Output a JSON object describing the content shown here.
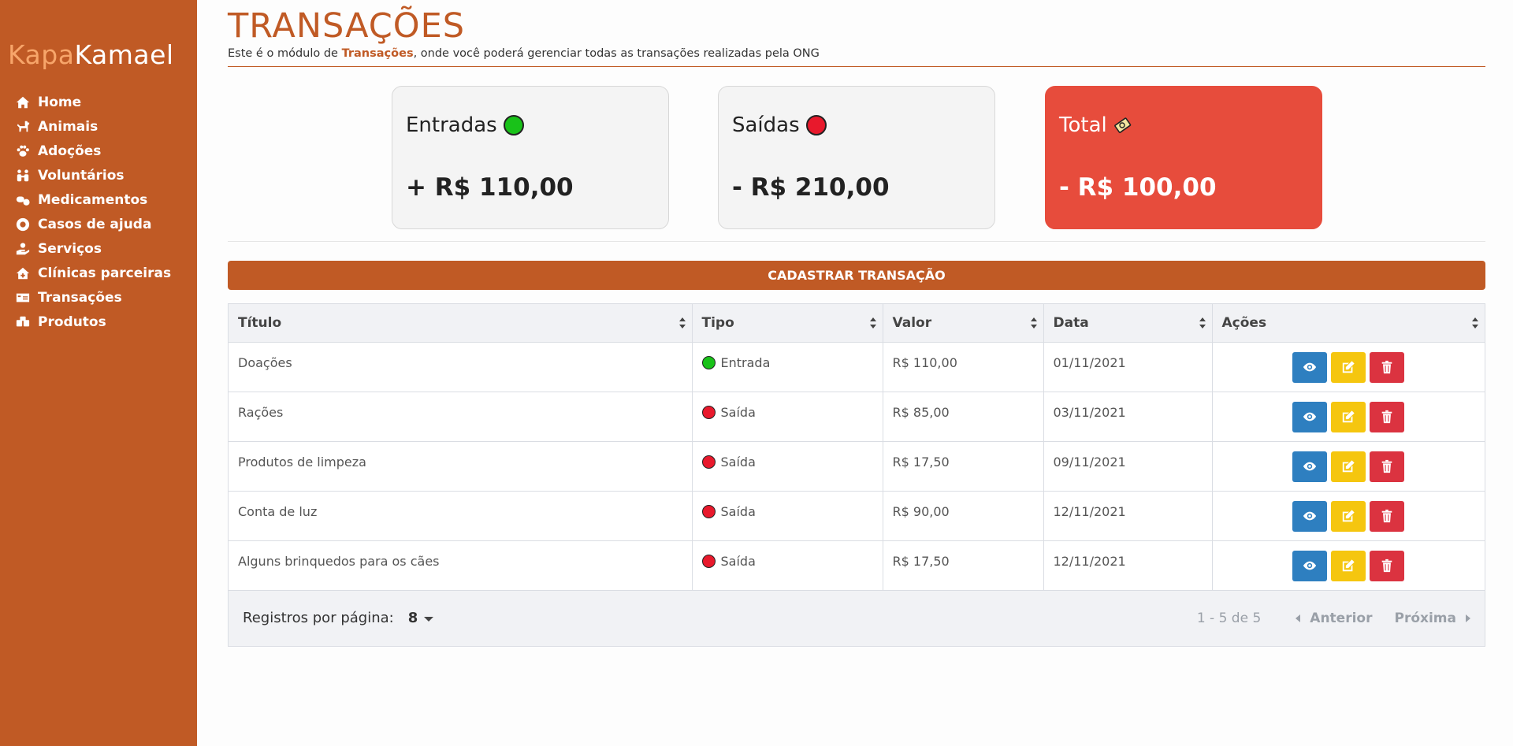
{
  "brand": {
    "part1": "Kapa",
    "part2": "Kamael"
  },
  "sidebar": {
    "items": [
      {
        "label": "Home",
        "icon": "home-icon"
      },
      {
        "label": "Animais",
        "icon": "dog-icon"
      },
      {
        "label": "Adoções",
        "icon": "paw-icon"
      },
      {
        "label": "Voluntários",
        "icon": "people-icon"
      },
      {
        "label": "Medicamentos",
        "icon": "pills-icon"
      },
      {
        "label": "Casos de ajuda",
        "icon": "lifebuoy-icon"
      },
      {
        "label": "Serviços",
        "icon": "hand-icon"
      },
      {
        "label": "Clínicas parceiras",
        "icon": "clinic-icon"
      },
      {
        "label": "Transações",
        "icon": "money-icon"
      },
      {
        "label": "Produtos",
        "icon": "boxes-icon"
      }
    ]
  },
  "header": {
    "title": "TRANSAÇÕES",
    "subtitle_pre": "Este é o módulo de ",
    "subtitle_bold": "Transações",
    "subtitle_post": ", onde você poderá gerenciar todas as transações realizadas pela ONG"
  },
  "cards": {
    "entradas": {
      "label": "Entradas",
      "value": "+ R$ 110,00",
      "dot_color": "#19c219"
    },
    "saidas": {
      "label": "Saídas",
      "value": "- R$ 210,00",
      "dot_color": "#e8192c"
    },
    "total": {
      "label": "Total",
      "value": "- R$ 100,00",
      "icon": "money-bag-icon",
      "color": "#e74c3c"
    }
  },
  "register_button": "CADASTRAR TRANSAÇÃO",
  "table": {
    "columns": [
      "Título",
      "Tipo",
      "Valor",
      "Data",
      "Ações"
    ],
    "rows": [
      {
        "titulo": "Doações",
        "tipo": "Entrada",
        "tipo_color": "#19c219",
        "valor": "R$ 110,00",
        "data": "01/11/2021"
      },
      {
        "titulo": "Rações",
        "tipo": "Saída",
        "tipo_color": "#e8192c",
        "valor": "R$ 85,00",
        "data": "03/11/2021"
      },
      {
        "titulo": "Produtos de limpeza",
        "tipo": "Saída",
        "tipo_color": "#e8192c",
        "valor": "R$ 17,50",
        "data": "09/11/2021"
      },
      {
        "titulo": "Conta de luz",
        "tipo": "Saída",
        "tipo_color": "#e8192c",
        "valor": "R$ 90,00",
        "data": "12/11/2021"
      },
      {
        "titulo": "Alguns brinquedos para os cães",
        "tipo": "Saída",
        "tipo_color": "#e8192c",
        "valor": "R$ 17,50",
        "data": "12/11/2021"
      }
    ],
    "action_colors": {
      "view": "#2e7fc0",
      "edit": "#f5c60f",
      "delete": "#db3340"
    }
  },
  "pagination": {
    "per_page_label": "Registros por página:",
    "per_page_value": "8",
    "range": "1 - 5 de 5",
    "prev": "Anterior",
    "next": "Próxima"
  },
  "colors": {
    "accent": "#c05a25",
    "brand_light": "#f7a56a"
  }
}
